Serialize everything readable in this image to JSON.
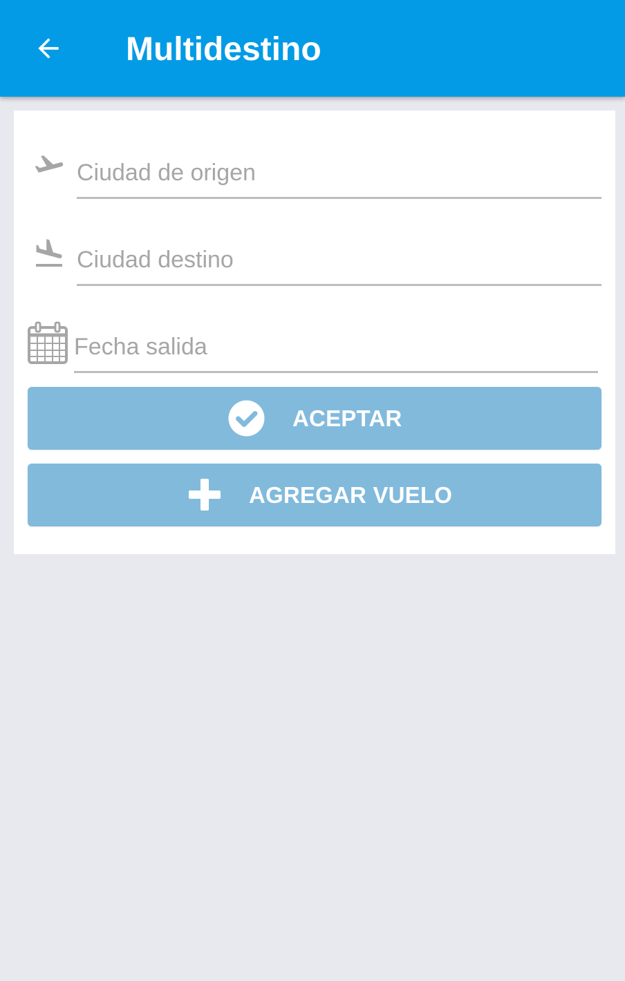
{
  "app_bar": {
    "title": "Multidestino",
    "back_icon": "arrow-back-icon",
    "background_color": "#039be5"
  },
  "form": {
    "origin": {
      "icon": "plane-departure-icon",
      "placeholder": "Ciudad de origen",
      "value": ""
    },
    "destination": {
      "icon": "plane-arrival-icon",
      "placeholder": "Ciudad destino",
      "value": ""
    },
    "departure_date": {
      "icon": "calendar-icon",
      "placeholder": "Fecha salida",
      "value": ""
    }
  },
  "buttons": {
    "accept": {
      "label": "ACEPTAR",
      "icon": "check-circle-icon"
    },
    "add_flight": {
      "label": "AGREGAR VUELO",
      "icon": "plus-icon"
    },
    "color": "#82badc"
  },
  "colors": {
    "screen_background": "#e8e8ef",
    "card_background": "#ffffff",
    "icon_gray": "#a6a6a6"
  }
}
